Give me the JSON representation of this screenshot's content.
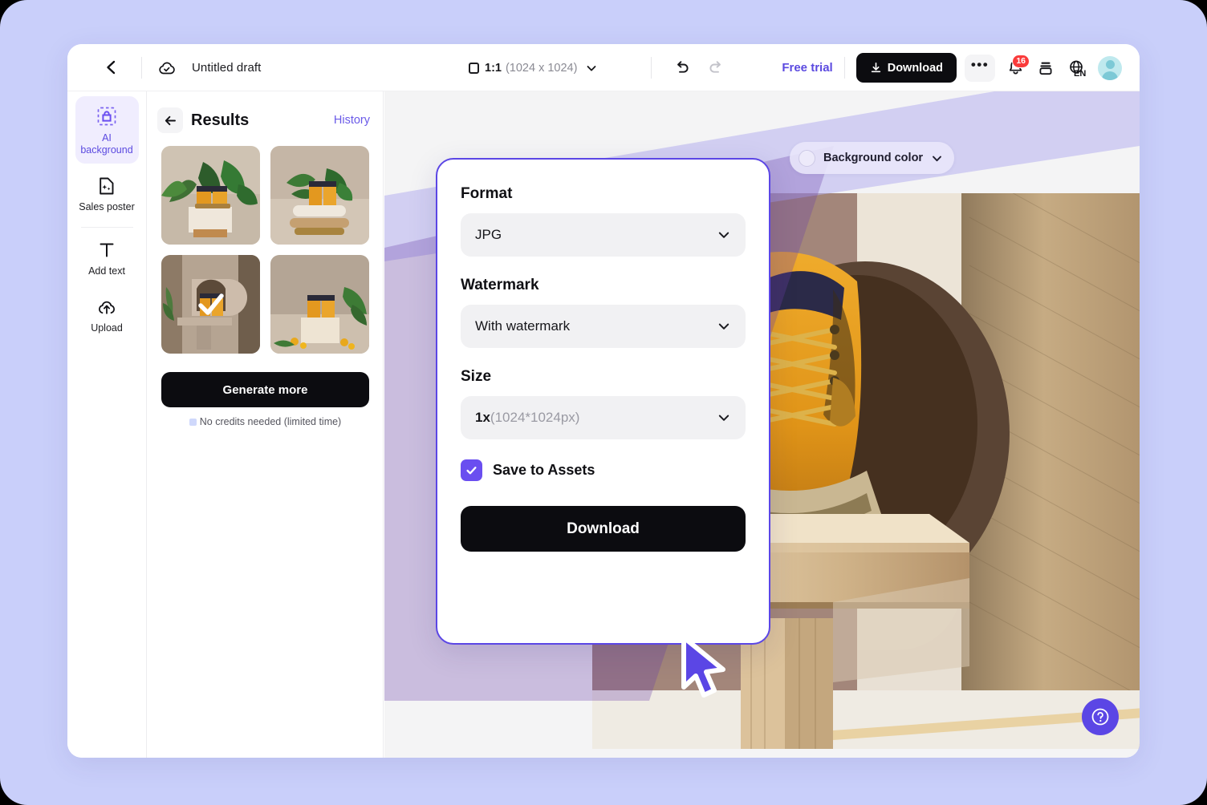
{
  "header": {
    "back_icon": "chevron-left-icon",
    "cloud_icon": "cloud-saved-icon",
    "doc_title": "Untitled draft",
    "ratio_label": "1:1",
    "ratio_dimensions": "(1024 x 1024)",
    "ratio_icon": "square-icon",
    "undo_icon": "undo-icon",
    "redo_icon": "redo-icon",
    "free_trial": "Free trial",
    "download_label": "Download",
    "download_icon": "download-icon",
    "more_label": "•••",
    "notifications_icon": "bell-icon",
    "notifications_count": "16",
    "layers_icon": "layers-icon",
    "language_icon": "globe-icon",
    "language_code": "EN",
    "avatar": "user-avatar"
  },
  "sidebar": {
    "items": [
      {
        "label": "AI\nbackground",
        "label_line1": "AI",
        "label_line2": "background",
        "icon": "ai-bag-icon",
        "active": true
      },
      {
        "label": "Sales poster",
        "icon": "sales-poster-icon",
        "active": false
      },
      {
        "label": "Add text",
        "icon": "text-icon",
        "active": false
      },
      {
        "label": "Upload",
        "icon": "upload-cloud-icon",
        "active": false
      }
    ]
  },
  "results_panel": {
    "back_icon": "arrow-left-icon",
    "title": "Results",
    "history_label": "History",
    "thumbnails": [
      {
        "name": "result-1",
        "selected": false
      },
      {
        "name": "result-2",
        "selected": false
      },
      {
        "name": "result-3",
        "selected": true
      },
      {
        "name": "result-4",
        "selected": false
      }
    ],
    "generate_label": "Generate more",
    "credits_note": "No credits needed (limited time)"
  },
  "canvas": {
    "background_color_label": "Background color",
    "background_color_swatch": "#ffffff",
    "chevron_icon": "chevron-down-icon",
    "help_icon": "question-mark-icon"
  },
  "modal": {
    "format_label": "Format",
    "format_value": "JPG",
    "watermark_label": "Watermark",
    "watermark_value": "With watermark",
    "size_label": "Size",
    "size_value_bold": "1x",
    "size_value_dim": "(1024*1024px)",
    "save_to_assets_label": "Save to Assets",
    "save_to_assets_checked": true,
    "check_icon": "check-icon",
    "download_label": "Download",
    "cursor_icon": "mouse-pointer-icon"
  },
  "colors": {
    "accent": "#5b46e5",
    "accent_light": "#6a4ef0",
    "page_background": "#c9cffa",
    "badge_red": "#fa3b3b",
    "black_button": "#0c0c10"
  }
}
